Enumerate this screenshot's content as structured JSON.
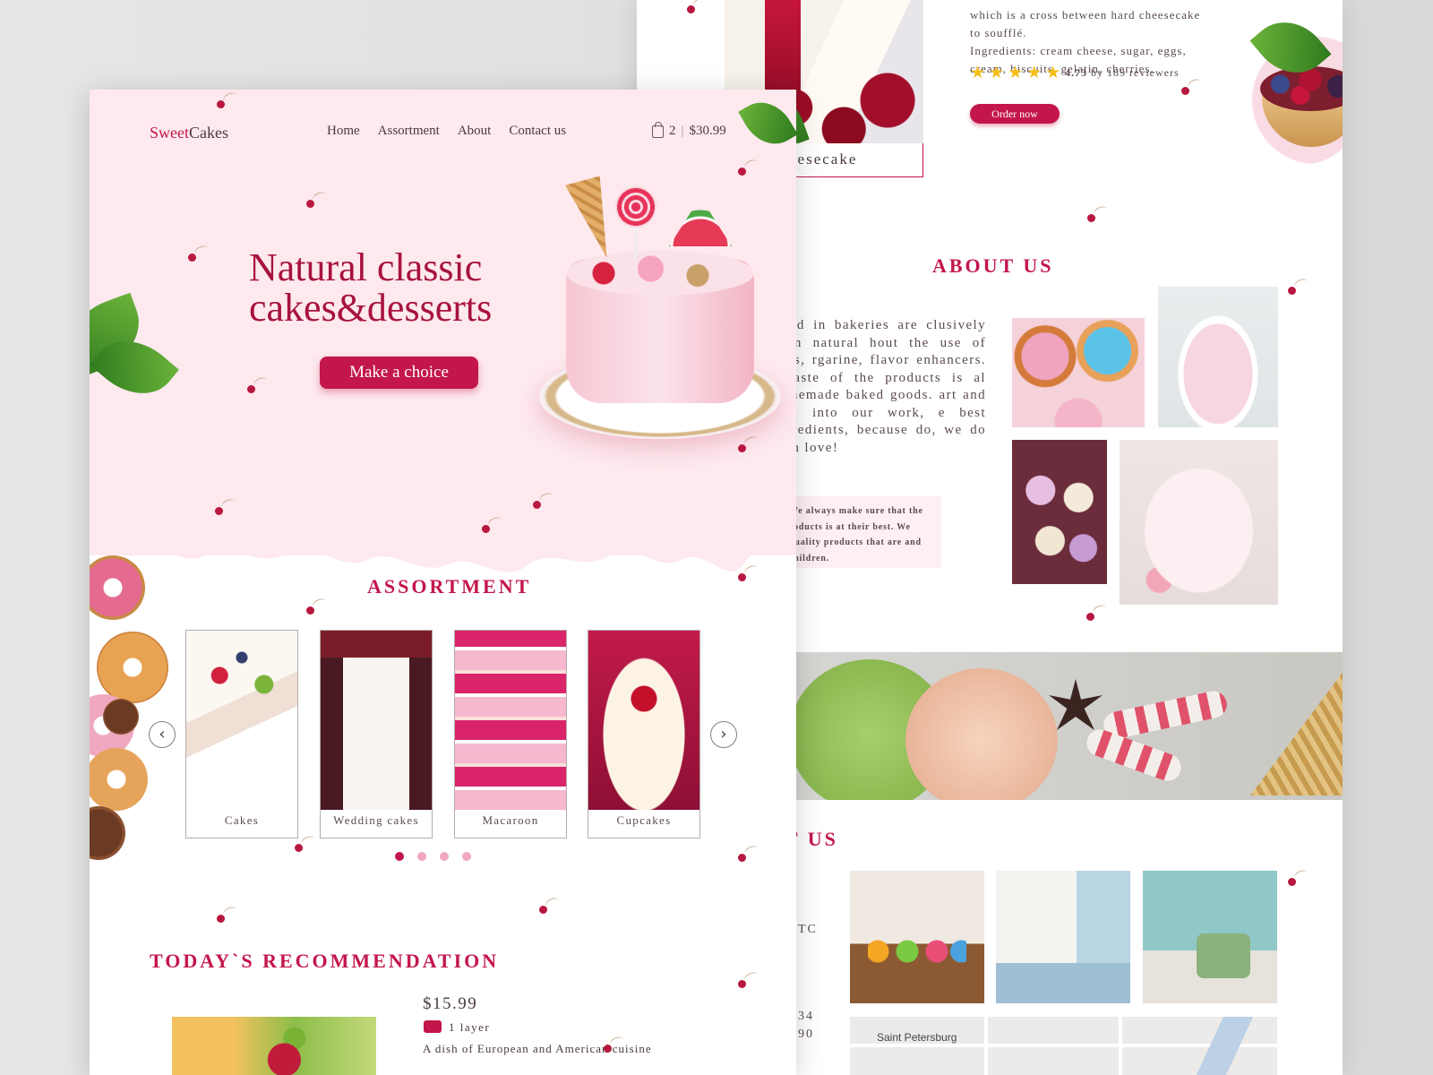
{
  "back": {
    "cheesecake_label": "eesecake",
    "description_lines": [
      "which is a cross between hard cheesecake",
      "to soufflé.",
      "Ingredients: cream cheese, sugar, eggs,",
      "cream, biscuits, gelatin, cherries."
    ],
    "rating_value": "4.73",
    "rating_suffix": "by 189 reviewers",
    "stars": 5,
    "order_button": "Order now",
    "about_title": "ABOUT US",
    "about_text": "fered in bakeries are clusively from natural hout the use of dyes, rgarine, flavor enhancers. e taste of the products is al homemade baked goods. art and soul into our work, e best ingredients, because do, we do with love!",
    "about_note": "We always make sure that the roducts is at their best. We quality products that are and children.",
    "contact_title": "T US",
    "contact_line1": "TC",
    "contact_line2": "34",
    "contact_line3": "90",
    "map_label": "Saint Petersburg"
  },
  "front": {
    "logo_accent": "Sweet",
    "logo_rest": "Cakes",
    "nav": [
      "Home",
      "Assortment",
      "About",
      "Contact us"
    ],
    "cart_count": "2",
    "cart_total": "$30.99",
    "hero_title_line1": "Natural classic",
    "hero_title_line2": "cakes&desserts",
    "hero_button": "Make a choice",
    "assortment_title": "ASSORTMENT",
    "categories": [
      "Cakes",
      "Wedding cakes",
      "Macaroon",
      "Cupcakes"
    ],
    "carousel_page": 1,
    "carousel_pages": 4,
    "recommendation_title": "TODAY`S RECOMMENDATION",
    "rec_price": "$15.99",
    "rec_layers": "1 layer",
    "rec_desc": "A dish of European and American cuisine"
  },
  "colors": {
    "accent": "#c3164b",
    "hero_bg": "#fde9ee",
    "title": "#a8123e",
    "star": "#f4bd1a"
  }
}
